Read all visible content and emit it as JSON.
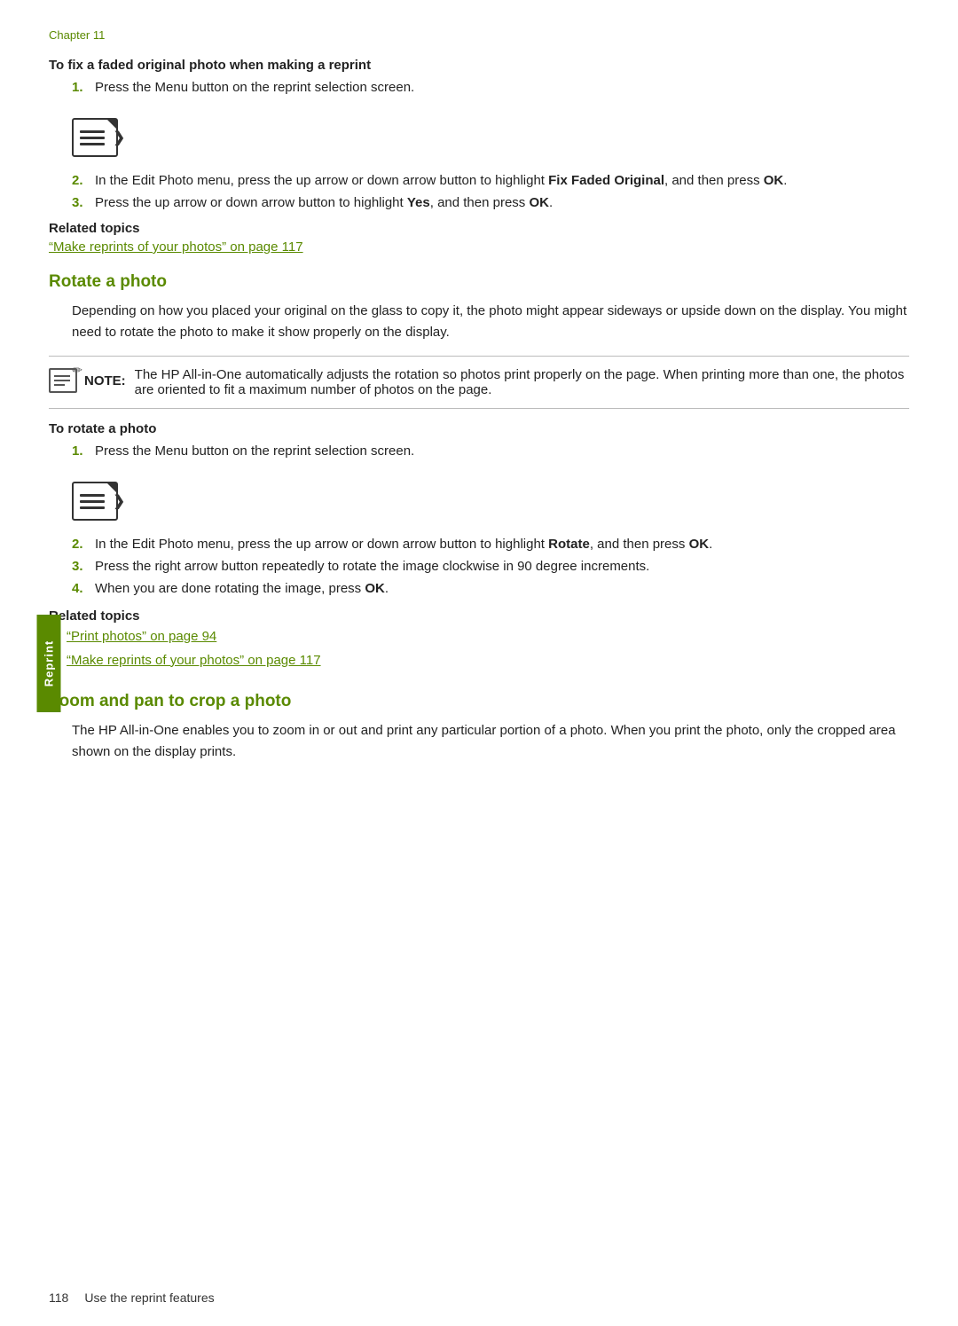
{
  "page": {
    "chapter": "Chapter 11",
    "footer": {
      "page_number": "118",
      "label": "Use the reprint features"
    },
    "side_tab": "Reprint"
  },
  "section_fix": {
    "instruction_heading": "To fix a faded original photo when making a reprint",
    "steps": [
      {
        "num": "1.",
        "text": "Press the Menu button on the reprint selection screen."
      },
      {
        "num": "2.",
        "text_before": "In the Edit Photo menu, press the up arrow or down arrow button to highlight ",
        "bold1": "Fix Faded Original",
        "text_mid": ", and then press ",
        "bold2": "OK",
        "text_after": "."
      },
      {
        "num": "3.",
        "text_before": "Press the up arrow or down arrow button to highlight ",
        "bold1": "Yes",
        "text_mid": ", and then press ",
        "bold2": "OK",
        "text_after": "."
      }
    ],
    "related_topics": {
      "heading": "Related topics",
      "links": [
        {
          "text": "“Make reprints of your photos” on page 117"
        }
      ]
    }
  },
  "section_rotate": {
    "heading": "Rotate a photo",
    "intro": "Depending on how you placed your original on the glass to copy it, the photo might appear sideways or upside down on the display. You might need to rotate the photo to make it show properly on the display.",
    "note": {
      "label": "NOTE:",
      "text": "The HP All-in-One automatically adjusts the rotation so photos print properly on the page. When printing more than one, the photos are oriented to fit a maximum number of photos on the page."
    },
    "instruction_heading": "To rotate a photo",
    "steps": [
      {
        "num": "1.",
        "text": "Press the Menu button on the reprint selection screen."
      },
      {
        "num": "2.",
        "text_before": "In the Edit Photo menu, press the up arrow or down arrow button to highlight ",
        "bold1": "Rotate",
        "text_mid": ", and then press ",
        "bold2": "OK",
        "text_after": "."
      },
      {
        "num": "3.",
        "text": "Press the right arrow button repeatedly to rotate the image clockwise in 90 degree increments."
      },
      {
        "num": "4.",
        "text_before": "When you are done rotating the image, press ",
        "bold1": "OK",
        "text_after": "."
      }
    ],
    "related_topics": {
      "heading": "Related topics",
      "links": [
        {
          "text": "“Print photos” on page 94"
        },
        {
          "text": "“Make reprints of your photos” on page 117"
        }
      ]
    }
  },
  "section_zoom": {
    "heading": "Zoom and pan to crop a photo",
    "intro": "The HP All-in-One enables you to zoom in or out and print any particular portion of a photo. When you print the photo, only the cropped area shown on the display prints."
  }
}
